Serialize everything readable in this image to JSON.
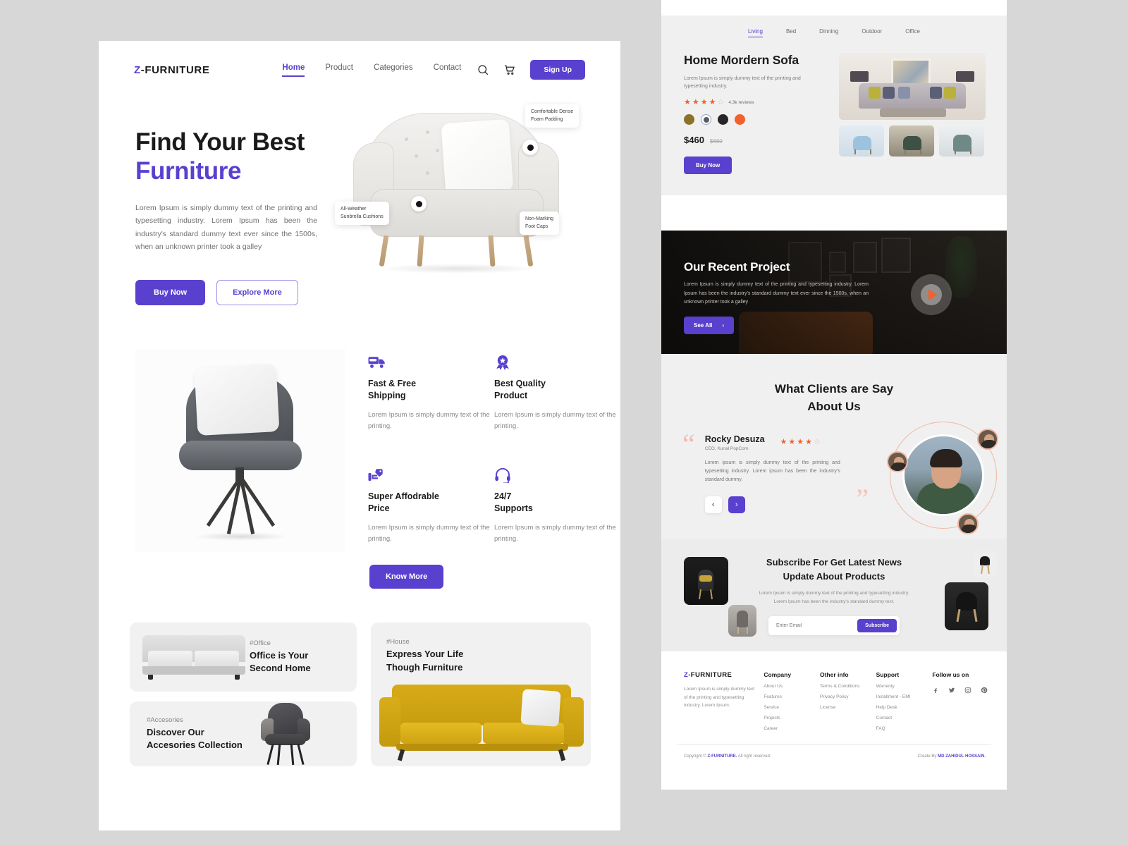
{
  "header": {
    "logo_z": "Z",
    "logo_rest": "-FURNITURE",
    "nav": [
      {
        "label": "Home",
        "active": true
      },
      {
        "label": "Product",
        "active": false
      },
      {
        "label": "Categories",
        "active": false
      },
      {
        "label": "Contact",
        "active": false
      }
    ],
    "search_icon": "search-icon",
    "cart_icon": "cart-icon",
    "signup_label": "Sign Up"
  },
  "hero": {
    "title_line1": "Find Your Best",
    "title_line2": "Furniture",
    "description": "Lorem Ipsum is simply dummy text of the printing and typesetting industry. Lorem Ipsum has been the industry's standard dummy text ever since the 1500s, when an unknown printer took a galley",
    "buy_label": "Buy Now",
    "explore_label": "Explore More",
    "tags": [
      {
        "line1": "Comfortable Dense",
        "line2": "Foam Padding"
      },
      {
        "line1": "All-Weather",
        "line2": "Sunbrella Cushions"
      },
      {
        "line1": "Non-Marking",
        "line2": "Foot Caps"
      }
    ]
  },
  "features": {
    "items": [
      {
        "icon": "free-shipping-truck-icon",
        "title_l1": "Fast & Free",
        "title_l2": "Shipping",
        "text": "Lorem Ipsum is simply dummy text of the printing."
      },
      {
        "icon": "quality-badge-icon",
        "title_l1": "Best Quality",
        "title_l2": "Product",
        "text": "Lorem Ipsum is simply dummy text of the printing."
      },
      {
        "icon": "price-tag-hand-icon",
        "title_l1": "Super Affodrable",
        "title_l2": "Price",
        "text": "Lorem Ipsum is simply dummy text of the printing."
      },
      {
        "icon": "headset-support-icon",
        "title_l1": "24/7",
        "title_l2": "Supports",
        "text": "Lorem Ipsum is simply dummy text of the printing."
      }
    ],
    "know_more_label": "Know More"
  },
  "categories": [
    {
      "tag": "#Office",
      "title_l1": "Office is Your",
      "title_l2": "Second Home"
    },
    {
      "tag": "#House",
      "title_l1": "Express Your Life",
      "title_l2": "Though Furniture"
    },
    {
      "tag": "#Accesories",
      "title_l1": "Discover Our",
      "title_l2": "Accesories Collection"
    }
  ],
  "product": {
    "tabs": [
      {
        "label": "Living",
        "active": true
      },
      {
        "label": "Bed",
        "active": false
      },
      {
        "label": "Dinning",
        "active": false
      },
      {
        "label": "Outdoor",
        "active": false
      },
      {
        "label": "Office",
        "active": false
      }
    ],
    "title": "Home Mordern Sofa",
    "description": "Lorem Ipsum is simply dummy text of the printing and typesetting industry.",
    "rating": 4,
    "rating_max": 5,
    "reviews": "4.3k reviews",
    "swatches": [
      "#8a7226",
      "selected",
      "#262626",
      "#f2612c"
    ],
    "price": "$460",
    "price_old": "$660",
    "buy_label": "Buy Now"
  },
  "project": {
    "title": "Our Recent Project",
    "text": "Lorem Ipsum is simply dummy text of the printing and typesetting industry. Lorem Ipsum has been the industry's standard dummy text ever since the 1500s, when an unknown printer took a galley",
    "see_all_label": "See All",
    "see_all_arrow": "›",
    "play_icon": "play-icon"
  },
  "testimonial": {
    "heading_l1": "What Clients are Say",
    "heading_l2": "About Us",
    "quote_open": "“",
    "quote_close": "”",
    "name": "Rocky Desuza",
    "role": "CEO, Kunal PopCorn",
    "rating": 4,
    "quote": "Lorem ipsum is simply dummy text of the printing and typesetting industry. Lorem ipsum has been the industry's standard dummy.",
    "prev_icon": "‹",
    "next_icon": "›"
  },
  "subscribe": {
    "heading_l1": "Subscribe For Get Latest News",
    "heading_l2": "Update About Products",
    "text_l1": "Lorem Ipsum is simply dummy text of the printing and typesetting industry.",
    "text_l2": "Lorem Ipsum has been the industry's standard dummy text.",
    "placeholder": "Enter Email",
    "input_value": "",
    "button_label": "Subscribe"
  },
  "footer": {
    "logo_z": "Z",
    "logo_rest": "-FURNITURE",
    "brand_text": "Lorem Ipsum is simply dummy text of the printing and typesetting industry. Lorem Ipsum.",
    "columns": [
      {
        "heading": "Company",
        "links": [
          "About Us",
          "Features",
          "Service",
          "Projects",
          "Career"
        ]
      },
      {
        "heading": "Other info",
        "links": [
          "Terms & Conditions",
          "Privacy Policy",
          "License"
        ]
      },
      {
        "heading": "Support",
        "links": [
          "Warrenty",
          "Installment - EMI",
          "Help Desk",
          "Contact",
          "FAQ"
        ]
      }
    ],
    "social_heading": "Follow us on",
    "social": [
      "facebook-icon",
      "twitter-icon",
      "instagram-icon",
      "pinterest-icon"
    ],
    "copyright_pre": "Copyright © ",
    "copyright_brand": "Z-FURNITURE.",
    "copyright_post": " All right reserved.",
    "credit_pre": "Create By ",
    "credit_name": "MD ZAHIDUL HOSSAIN."
  },
  "colors": {
    "accent": "#5a40cf",
    "orange": "#f2612c",
    "peach": "#f0b9a5",
    "yellow": "#d8ab17"
  }
}
